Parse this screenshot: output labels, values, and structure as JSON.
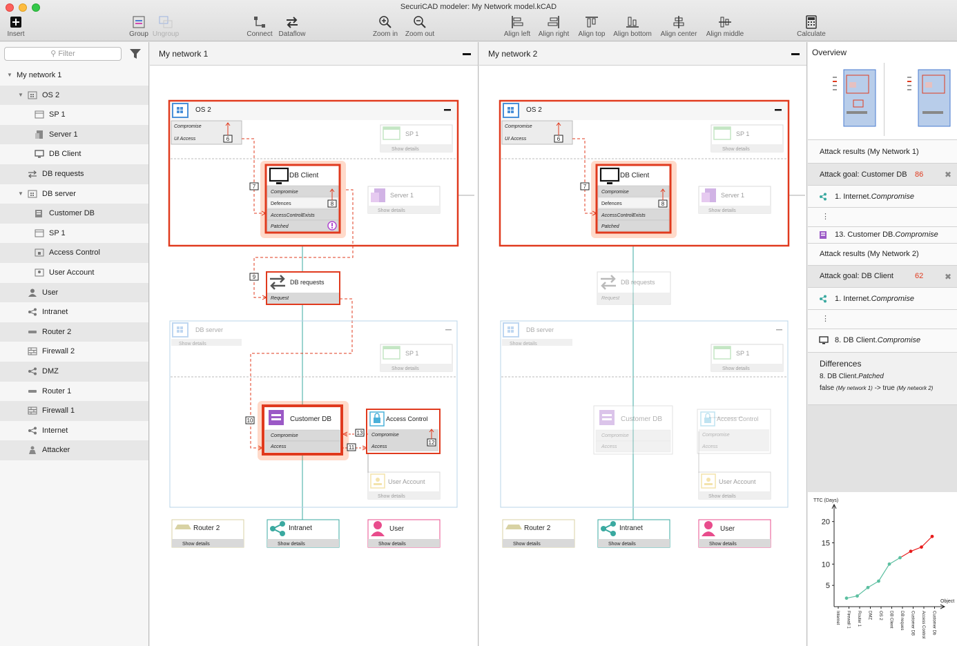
{
  "window": {
    "title": "SecuriCAD modeler: My Network model.kCAD"
  },
  "toolbar": {
    "insert": "Insert",
    "group": "Group",
    "ungroup": "Ungroup",
    "connect": "Connect",
    "dataflow": "Dataflow",
    "zoom_in": "Zoom in",
    "zoom_out": "Zoom out",
    "align_left": "Align left",
    "align_right": "Align right",
    "align_top": "Align top",
    "align_bottom": "Align bottom",
    "align_center": "Align center",
    "align_middle": "Align middle",
    "calculate": "Calculate"
  },
  "sidebar": {
    "filter_placeholder": "Filter",
    "items": [
      {
        "label": "My network 1",
        "icon": "network-icon",
        "level": 0,
        "expanded": true
      },
      {
        "label": "OS 2",
        "icon": "os-icon",
        "level": 1,
        "expanded": true
      },
      {
        "label": "SP 1",
        "icon": "window-icon",
        "level": 2
      },
      {
        "label": "Server 1",
        "icon": "server-icon",
        "level": 2
      },
      {
        "label": "DB Client",
        "icon": "monitor-icon",
        "level": 2
      },
      {
        "label": "DB requests",
        "icon": "dataflow-icon",
        "level": 1
      },
      {
        "label": "DB server",
        "icon": "os-icon",
        "level": 1,
        "expanded": true
      },
      {
        "label": "Customer DB",
        "icon": "database-icon",
        "level": 2
      },
      {
        "label": "SP 1",
        "icon": "window-icon",
        "level": 2
      },
      {
        "label": "Access Control",
        "icon": "lock-icon",
        "level": 2
      },
      {
        "label": "User Account",
        "icon": "account-icon",
        "level": 2
      },
      {
        "label": "User",
        "icon": "user-icon",
        "level": 1
      },
      {
        "label": "Intranet",
        "icon": "share-icon",
        "level": 1
      },
      {
        "label": "Router 2",
        "icon": "router-icon",
        "level": 1
      },
      {
        "label": "Firewall 2",
        "icon": "firewall-icon",
        "level": 1
      },
      {
        "label": "DMZ",
        "icon": "share-icon",
        "level": 1
      },
      {
        "label": "Router 1",
        "icon": "router-icon",
        "level": 1
      },
      {
        "label": "Firewall 1",
        "icon": "firewall-icon",
        "level": 1
      },
      {
        "label": "Internet",
        "icon": "share-icon",
        "level": 1
      },
      {
        "label": "Attacker",
        "icon": "attacker-icon",
        "level": 1
      }
    ]
  },
  "panes": [
    {
      "title": "My network 1",
      "os_group": {
        "title": "OS 2",
        "attack_rows": [
          "Compromise",
          "UI Access"
        ],
        "badge": "6"
      },
      "sp1": {
        "title": "SP 1",
        "details": "Show details"
      },
      "server1": {
        "title": "Server 1",
        "details": "Show details"
      },
      "db_client": {
        "title": "DB Client",
        "rows": [
          "Compromise",
          "Defences",
          "AccessControlExists",
          "Patched"
        ],
        "badge_defences": "8",
        "badge_left": "7"
      },
      "db_requests": {
        "title": "DB requests",
        "rows": [
          "Request"
        ],
        "badge_left": "9"
      },
      "db_server": {
        "title": "DB server",
        "details": "Show details"
      },
      "sp1b": {
        "title": "SP 1",
        "details": "Show details"
      },
      "customer_db": {
        "title": "Customer DB",
        "rows": [
          "Compromise",
          "Access"
        ],
        "badge_left": "10"
      },
      "access_control": {
        "title": "Access Control",
        "rows": [
          "Compromise",
          "Access"
        ],
        "badge_left_top": "13",
        "badge_left_bottom": "11",
        "badge_right": "12"
      },
      "user_account": {
        "title": "User Account",
        "details": "Show details"
      },
      "router2": {
        "title": "Router 2",
        "details": "Show details"
      },
      "intranet": {
        "title": "Intranet",
        "details": "Show details"
      },
      "user": {
        "title": "User",
        "details": "Show details"
      }
    },
    {
      "title": "My network 2",
      "os_group": {
        "title": "OS 2",
        "attack_rows": [
          "Compromise",
          "UI Access"
        ],
        "badge": "6"
      },
      "sp1": {
        "title": "SP 1",
        "details": "Show details"
      },
      "server1": {
        "title": "Server 1",
        "details": "Show details"
      },
      "db_client": {
        "title": "DB Client",
        "rows": [
          "Compromise",
          "Defences",
          "AccessControlExists",
          "Patched"
        ],
        "badge_defences": "8",
        "badge_left": "7"
      },
      "db_requests": {
        "title": "DB requests",
        "rows": [
          "Request"
        ]
      },
      "db_server": {
        "title": "DB server",
        "details": "Show details"
      },
      "sp1b": {
        "title": "SP 1",
        "details": "Show details"
      },
      "customer_db": {
        "title": "Customer DB",
        "rows": [
          "Compromise",
          "Access"
        ]
      },
      "access_control": {
        "title": "Access Control",
        "rows": [
          "Compromise",
          "Access"
        ]
      },
      "user_account": {
        "title": "User Account",
        "details": "Show details"
      },
      "router2": {
        "title": "Router 2",
        "details": "Show details"
      },
      "intranet": {
        "title": "Intranet",
        "details": "Show details"
      },
      "user": {
        "title": "User",
        "details": "Show details"
      }
    }
  ],
  "right": {
    "overview_title": "Overview",
    "results1": {
      "title": "Attack results (My Network 1)",
      "goal_label": "Attack goal: Customer DB",
      "goal_value": "86",
      "step1": "1. Internet.",
      "step1_em": "Compromise",
      "step_last": "13. Customer DB.",
      "step_last_em": "Compromise"
    },
    "results2": {
      "title": "Attack results (My Network 2)",
      "goal_label": "Attack goal: DB Client",
      "goal_value": "62",
      "step1": "1. Internet.",
      "step1_em": "Compromise",
      "step_last": "8. DB Client.",
      "step_last_em": "Compromise"
    },
    "differences": {
      "title": "Differences",
      "item": "8. DB Client.",
      "item_em": "Patched",
      "from": "false",
      "from_note": "(My network 1)",
      "arrow": "->",
      "to": "true",
      "to_note": "(My network 2)"
    }
  },
  "colors": {
    "attack_red": "#e03a1e",
    "goal_red": "#e03a1e",
    "teal": "#3aa9a0",
    "chart_green": "#5bbfa0",
    "chart_red": "#e81c1c"
  },
  "chart_data": {
    "type": "line",
    "ylabel": "TTC (Days)",
    "xlabel": "Object",
    "categories": [
      "Internet",
      "Firewall 1",
      "Router 1",
      "DMZ",
      "OS 2",
      "DB Client",
      "DB reques",
      "Customer DB",
      "Access Control",
      "Customer Db"
    ],
    "values": [
      2,
      2.5,
      4.5,
      6,
      10,
      11.5,
      13,
      14,
      16.5
    ],
    "color_split_index": 5,
    "yticks": [
      5,
      10,
      15,
      20
    ],
    "ylim": [
      0,
      24
    ]
  }
}
